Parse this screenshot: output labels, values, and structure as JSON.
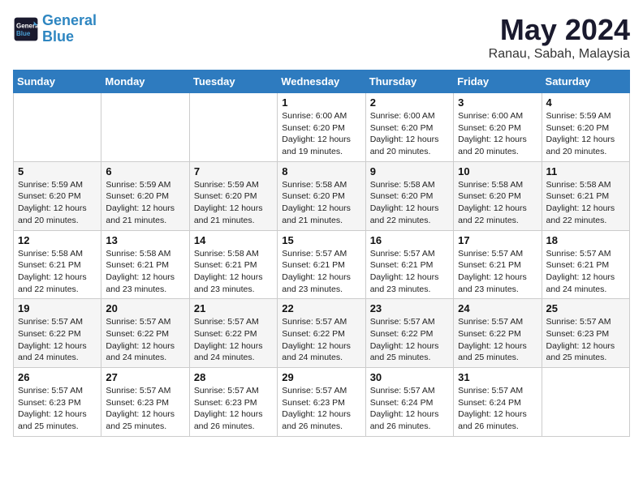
{
  "header": {
    "logo_line1": "General",
    "logo_line2": "Blue",
    "month_year": "May 2024",
    "location": "Ranau, Sabah, Malaysia"
  },
  "weekdays": [
    "Sunday",
    "Monday",
    "Tuesday",
    "Wednesday",
    "Thursday",
    "Friday",
    "Saturday"
  ],
  "weeks": [
    [
      {
        "day": "",
        "info": ""
      },
      {
        "day": "",
        "info": ""
      },
      {
        "day": "",
        "info": ""
      },
      {
        "day": "1",
        "info": "Sunrise: 6:00 AM\nSunset: 6:20 PM\nDaylight: 12 hours\nand 19 minutes."
      },
      {
        "day": "2",
        "info": "Sunrise: 6:00 AM\nSunset: 6:20 PM\nDaylight: 12 hours\nand 20 minutes."
      },
      {
        "day": "3",
        "info": "Sunrise: 6:00 AM\nSunset: 6:20 PM\nDaylight: 12 hours\nand 20 minutes."
      },
      {
        "day": "4",
        "info": "Sunrise: 5:59 AM\nSunset: 6:20 PM\nDaylight: 12 hours\nand 20 minutes."
      }
    ],
    [
      {
        "day": "5",
        "info": "Sunrise: 5:59 AM\nSunset: 6:20 PM\nDaylight: 12 hours\nand 20 minutes."
      },
      {
        "day": "6",
        "info": "Sunrise: 5:59 AM\nSunset: 6:20 PM\nDaylight: 12 hours\nand 21 minutes."
      },
      {
        "day": "7",
        "info": "Sunrise: 5:59 AM\nSunset: 6:20 PM\nDaylight: 12 hours\nand 21 minutes."
      },
      {
        "day": "8",
        "info": "Sunrise: 5:58 AM\nSunset: 6:20 PM\nDaylight: 12 hours\nand 21 minutes."
      },
      {
        "day": "9",
        "info": "Sunrise: 5:58 AM\nSunset: 6:20 PM\nDaylight: 12 hours\nand 22 minutes."
      },
      {
        "day": "10",
        "info": "Sunrise: 5:58 AM\nSunset: 6:20 PM\nDaylight: 12 hours\nand 22 minutes."
      },
      {
        "day": "11",
        "info": "Sunrise: 5:58 AM\nSunset: 6:21 PM\nDaylight: 12 hours\nand 22 minutes."
      }
    ],
    [
      {
        "day": "12",
        "info": "Sunrise: 5:58 AM\nSunset: 6:21 PM\nDaylight: 12 hours\nand 22 minutes."
      },
      {
        "day": "13",
        "info": "Sunrise: 5:58 AM\nSunset: 6:21 PM\nDaylight: 12 hours\nand 23 minutes."
      },
      {
        "day": "14",
        "info": "Sunrise: 5:58 AM\nSunset: 6:21 PM\nDaylight: 12 hours\nand 23 minutes."
      },
      {
        "day": "15",
        "info": "Sunrise: 5:57 AM\nSunset: 6:21 PM\nDaylight: 12 hours\nand 23 minutes."
      },
      {
        "day": "16",
        "info": "Sunrise: 5:57 AM\nSunset: 6:21 PM\nDaylight: 12 hours\nand 23 minutes."
      },
      {
        "day": "17",
        "info": "Sunrise: 5:57 AM\nSunset: 6:21 PM\nDaylight: 12 hours\nand 23 minutes."
      },
      {
        "day": "18",
        "info": "Sunrise: 5:57 AM\nSunset: 6:21 PM\nDaylight: 12 hours\nand 24 minutes."
      }
    ],
    [
      {
        "day": "19",
        "info": "Sunrise: 5:57 AM\nSunset: 6:22 PM\nDaylight: 12 hours\nand 24 minutes."
      },
      {
        "day": "20",
        "info": "Sunrise: 5:57 AM\nSunset: 6:22 PM\nDaylight: 12 hours\nand 24 minutes."
      },
      {
        "day": "21",
        "info": "Sunrise: 5:57 AM\nSunset: 6:22 PM\nDaylight: 12 hours\nand 24 minutes."
      },
      {
        "day": "22",
        "info": "Sunrise: 5:57 AM\nSunset: 6:22 PM\nDaylight: 12 hours\nand 24 minutes."
      },
      {
        "day": "23",
        "info": "Sunrise: 5:57 AM\nSunset: 6:22 PM\nDaylight: 12 hours\nand 25 minutes."
      },
      {
        "day": "24",
        "info": "Sunrise: 5:57 AM\nSunset: 6:22 PM\nDaylight: 12 hours\nand 25 minutes."
      },
      {
        "day": "25",
        "info": "Sunrise: 5:57 AM\nSunset: 6:23 PM\nDaylight: 12 hours\nand 25 minutes."
      }
    ],
    [
      {
        "day": "26",
        "info": "Sunrise: 5:57 AM\nSunset: 6:23 PM\nDaylight: 12 hours\nand 25 minutes."
      },
      {
        "day": "27",
        "info": "Sunrise: 5:57 AM\nSunset: 6:23 PM\nDaylight: 12 hours\nand 25 minutes."
      },
      {
        "day": "28",
        "info": "Sunrise: 5:57 AM\nSunset: 6:23 PM\nDaylight: 12 hours\nand 26 minutes."
      },
      {
        "day": "29",
        "info": "Sunrise: 5:57 AM\nSunset: 6:23 PM\nDaylight: 12 hours\nand 26 minutes."
      },
      {
        "day": "30",
        "info": "Sunrise: 5:57 AM\nSunset: 6:24 PM\nDaylight: 12 hours\nand 26 minutes."
      },
      {
        "day": "31",
        "info": "Sunrise: 5:57 AM\nSunset: 6:24 PM\nDaylight: 12 hours\nand 26 minutes."
      },
      {
        "day": "",
        "info": ""
      }
    ]
  ]
}
